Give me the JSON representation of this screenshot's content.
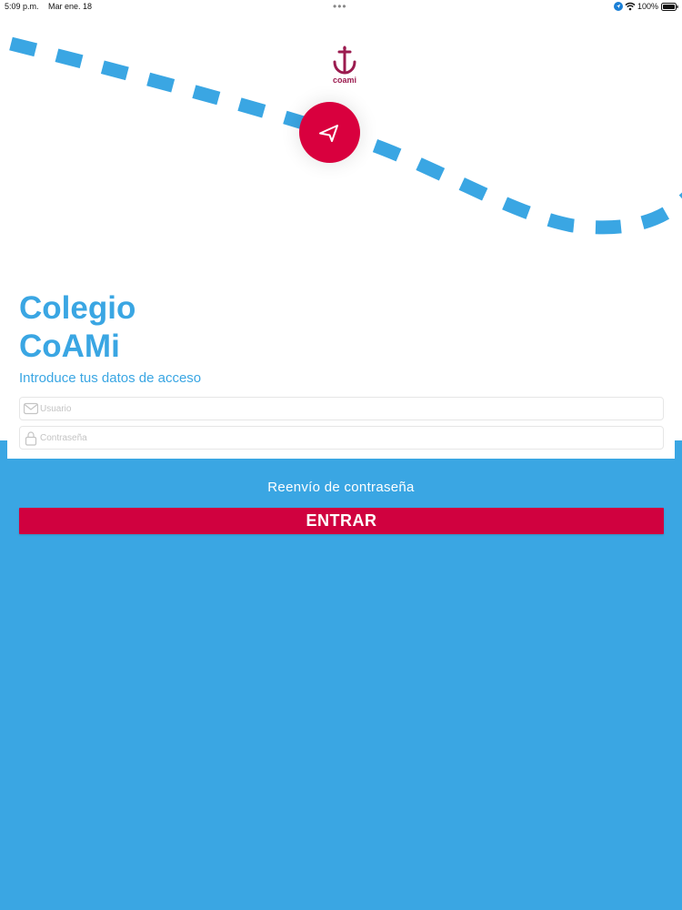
{
  "status_bar": {
    "time": "5:09 p.m.",
    "date": "Mar ene. 18",
    "dots": "•••",
    "battery_percent": "100%"
  },
  "logo": {
    "text": "coami"
  },
  "login": {
    "title_line1": "Colegio",
    "title_line2": "CoAMi",
    "subtitle": "Introduce tus datos de acceso",
    "username_placeholder": "Usuario",
    "password_placeholder": "Contraseña",
    "resend_label": "Reenvío de contraseña",
    "enter_label": "ENTRAR"
  },
  "colors": {
    "primary_blue": "#3aa6e3",
    "accent_red": "#d0013f",
    "logo_maroon": "#9b1b4f"
  },
  "icons": {
    "navigation": "navigation-arrow-icon",
    "username": "envelope-icon",
    "password": "lock-icon"
  }
}
